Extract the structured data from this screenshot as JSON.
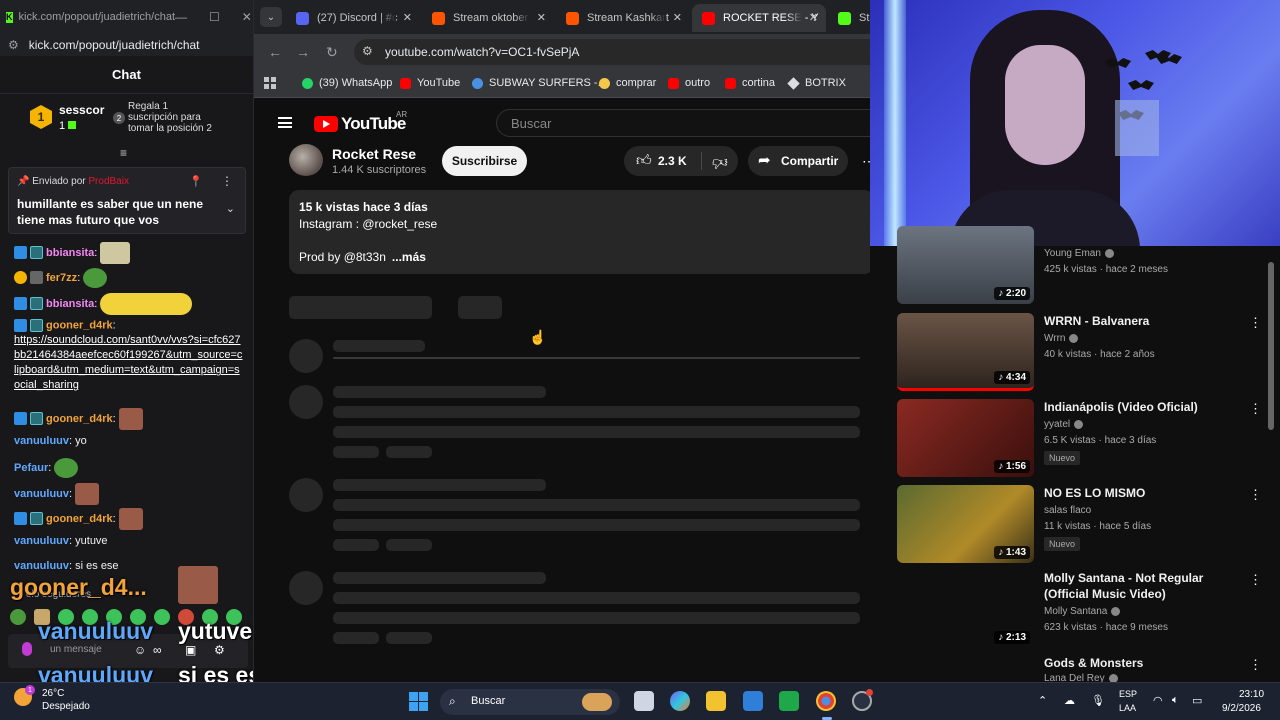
{
  "kick": {
    "window_title": "kick.com/popout/juadietrich/chat",
    "url": "kick.com/popout/juadietrich/chat",
    "chat_header": "Chat",
    "leaderboard": {
      "rank": "1",
      "username": "sesscor",
      "count": "1",
      "rank2": "2",
      "gift_line1": "Regala 1",
      "gift_line2": "suscripción para",
      "gift_line3": "tomar la posición 2"
    },
    "pinned": {
      "sent_by_label": "Enviado por",
      "sent_by_user": "ProdBaix",
      "text": "humillante es saber que un nene tiene mas futuro que vos"
    },
    "messages": [
      {
        "user": "bbiansita",
        "text": "",
        "color": "#f287f0"
      },
      {
        "user": "fer7zz",
        "text": "",
        "color": "#f2a33a"
      },
      {
        "user": "bbiansita",
        "text": "",
        "color": "#f287f0"
      },
      {
        "user": "gooner_d4rk",
        "text": "https://soundcloud.com/sant0vv/vvs?si=cfc627bb21464384aeefcec60f199267&utm_source=clipboard&utm_medium=text&utm_campaign=social_sharing",
        "color": "#f2a33a"
      },
      {
        "user": "gooner_d4rk",
        "text": "",
        "color": "#f2a33a"
      },
      {
        "user": "vanuuluuv",
        "text": "yo",
        "color": "#5fa8ff"
      },
      {
        "user": "Pefaur",
        "text": "",
        "color": "#5fa8ff"
      },
      {
        "user": "vanuuluuv",
        "text": "",
        "color": "#5fa8ff"
      },
      {
        "user": "gooner_d4rk",
        "text": "",
        "color": "#f2a33a"
      },
      {
        "user": "vanuuluuv",
        "text": "yutuve",
        "color": "#5fa8ff"
      },
      {
        "user": "vanuuluuv",
        "text": "si es ese",
        "color": "#5fa8ff"
      }
    ],
    "followers_only": "olo seguidores",
    "input_placeholder": "un mensaje",
    "overlay": {
      "line1": "gooner_d4...",
      "line2_user": "vanuuluuv",
      "line2_text": "yutuve",
      "line3_user": "vanuuluuv",
      "line3_text": "si es ese"
    }
  },
  "browser": {
    "tabs": [
      {
        "label": "(27) Discord | #c",
        "active": false,
        "favicon_color": "#5865f2"
      },
      {
        "label": "Stream oktober",
        "active": false,
        "favicon_color": "#ff5500"
      },
      {
        "label": "Stream Kashkart",
        "active": false,
        "favicon_color": "#ff5500"
      },
      {
        "label": "ROCKET RESE - Y",
        "active": true,
        "favicon_color": "#ff0000"
      },
      {
        "label": "Stre",
        "active": false,
        "favicon_color": "#53fc18"
      }
    ],
    "url": "youtube.com/watch?v=OC1-fvSePjA",
    "bookmarks": [
      {
        "label": "(39) WhatsApp",
        "color": "#25d366"
      },
      {
        "label": "YouTube",
        "color": "#ff0000"
      },
      {
        "label": "SUBWAY SURFERS -...",
        "color": "#4a90e2"
      },
      {
        "label": "comprar",
        "color": "#f2c94c"
      },
      {
        "label": "outro",
        "color": "#ff0000"
      },
      {
        "label": "cortina",
        "color": "#ff0000"
      },
      {
        "label": "BOTRIX",
        "color": "#dddddd"
      }
    ]
  },
  "youtube": {
    "logo_text": "YouTube",
    "country": "AR",
    "search_placeholder": "Buscar",
    "channel_name": "Rocket Rese",
    "subscribers": "1.44 K suscriptores",
    "subscribe_label": "Suscribirse",
    "likes": "2.3 K",
    "share_label": "Compartir",
    "description": {
      "stats": "15 k vistas  hace 3 días",
      "line2": "Instagram : @rocket_rese",
      "line3": "Prod by @8t33n",
      "more": "...más"
    }
  },
  "recommendations": [
    {
      "title": "",
      "channel": "Young Eman",
      "meta": "425 k vistas · hace 2 meses",
      "duration": "2:20",
      "new": "",
      "thumb_color": "#5b6470"
    },
    {
      "title": "WRRN - Balvanera",
      "channel": "Wrrn",
      "meta": "40 k vistas · hace 2 años",
      "duration": "4:34",
      "new": "",
      "thumb_color": "#4a3a30"
    },
    {
      "title": "Indianápolis (Video Oficial)",
      "channel": "yyatel",
      "meta": "6.5 K vistas · hace 3 días",
      "duration": "1:56",
      "new": "Nuevo",
      "thumb_color": "#7a2420"
    },
    {
      "title": "NO ES LO MISMO",
      "channel": "salas flaco",
      "meta": "11 k vistas · hace 5 días",
      "duration": "1:43",
      "new": "Nuevo",
      "thumb_color": "#a08020"
    },
    {
      "title": "Molly Santana - Not Regular (Official Music Video)",
      "channel": "Molly Santana",
      "meta": "623 k vistas · hace 9 meses",
      "duration": "2:13",
      "new": "",
      "thumb_color": "#0f0f0f"
    },
    {
      "title": "Gods & Monsters",
      "channel": "Lana Del Rey",
      "meta": "",
      "duration": "",
      "new": "",
      "thumb_color": "#0f0f0f"
    }
  ],
  "taskbar": {
    "weather_badge": "1",
    "temperature": "26°C",
    "weather": "Despejado",
    "search_label": "Buscar",
    "lang1": "ESP",
    "lang2": "LAA",
    "time": "23:10",
    "date": "9/2/2026"
  }
}
